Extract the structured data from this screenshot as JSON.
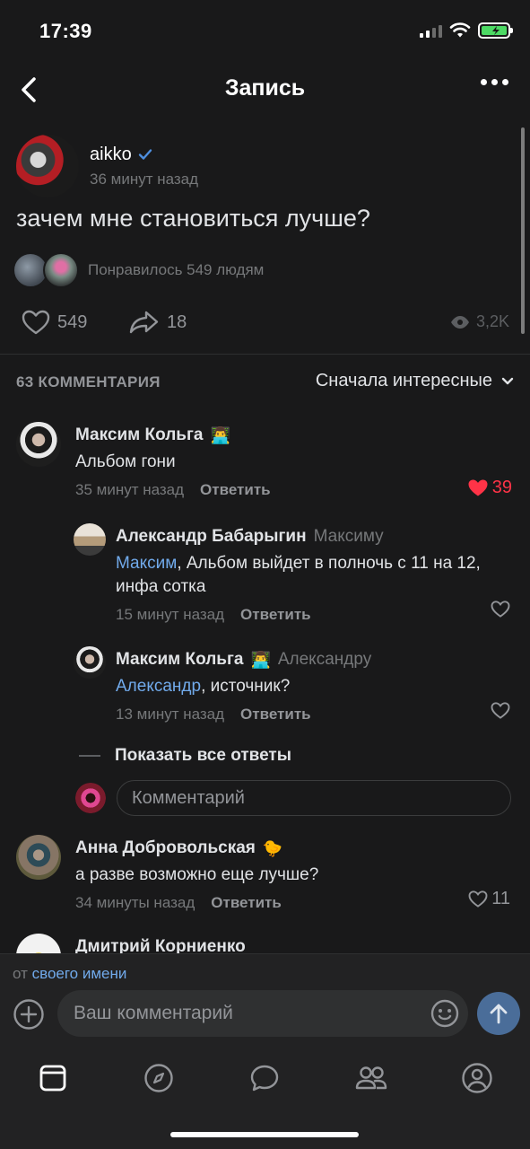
{
  "status_bar": {
    "time": "17:39"
  },
  "nav": {
    "title": "Запись"
  },
  "post": {
    "author": "aikko",
    "verified": true,
    "time": "36 минут назад",
    "text": "зачем мне становиться лучше?",
    "likes_text": "Понравилось 549 людям",
    "like_count": "549",
    "share_count": "18",
    "views": "3,2K"
  },
  "comments_header": {
    "count": "63 КОММЕНТАРИЯ",
    "sort": "Сначала интересные"
  },
  "comments": [
    {
      "author": "Максим Кольга",
      "emoji": "👨‍💻",
      "text": "Альбом гони",
      "time": "35 минут назад",
      "reply": "Ответить",
      "likes": "39",
      "liked": true
    },
    {
      "author": "Александр Бабарыгин",
      "reply_to": "Максиму",
      "mention": "Максим",
      "text": ", Альбом выйдет в полночь с 11 на 12, инфа сотка",
      "time": "15 минут назад",
      "reply": "Ответить"
    },
    {
      "author": "Максим Кольга",
      "emoji": "👨‍💻",
      "reply_to": "Александру",
      "mention": "Александр",
      "text": ", источник?",
      "time": "13 минут назад",
      "reply": "Ответить"
    },
    {
      "author": "Анна Добровольская",
      "emoji": "🐤",
      "text": "а разве возможно еще лучше?",
      "time": "34 минуты назад",
      "reply": "Ответить",
      "likes": "11"
    },
    {
      "author": "Дмитрий Корниенко"
    }
  ],
  "show_all_replies": "Показать все ответы",
  "inline_comment_placeholder": "Комментарий",
  "composer": {
    "from_prefix": "от",
    "from_link": "своего имени",
    "placeholder": "Ваш комментарий"
  },
  "colors": {
    "background": "#19191a",
    "accent_blue": "#71aaeb",
    "like_red": "#ff3347",
    "send_button": "#4a6d99"
  },
  "tabs": [
    "newsfeed-icon",
    "discover-icon",
    "messages-icon",
    "friends-icon",
    "profile-icon"
  ]
}
